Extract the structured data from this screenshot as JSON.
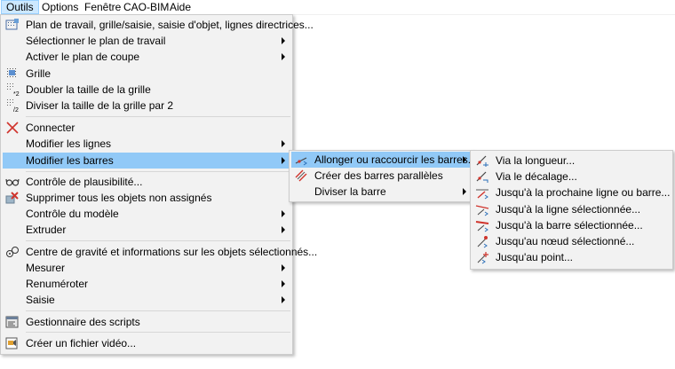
{
  "menubar": {
    "items": [
      "Outils",
      "Options",
      "Fenêtre",
      "CAO-BIM",
      "Aide"
    ]
  },
  "outils_menu": {
    "items": [
      {
        "label": "Plan de travail, grille/saisie, saisie d'objet, lignes directrices...",
        "icon": "workplane-grid-icon"
      },
      {
        "label": "Sélectionner le plan de travail",
        "submenu": true
      },
      {
        "label": "Activer le plan de coupe",
        "submenu": true
      },
      {
        "label": "Grille",
        "icon": "grid-icon"
      },
      {
        "label": "Doubler la taille de la grille",
        "icon": "grid-double-icon"
      },
      {
        "label": "Diviser la taille de la grille par 2",
        "icon": "grid-half-icon"
      },
      {
        "label": "Connecter",
        "icon": "connect-cross-icon"
      },
      {
        "label": "Modifier les lignes",
        "submenu": true
      },
      {
        "label": "Modifier les barres",
        "submenu": true,
        "highlighted": true
      },
      {
        "label": "Contrôle de plausibilité...",
        "icon": "glasses-icon"
      },
      {
        "label": "Supprimer tous les objets non assignés",
        "icon": "delete-unassigned-icon"
      },
      {
        "label": "Contrôle du modèle",
        "submenu": true
      },
      {
        "label": "Extruder",
        "submenu": true
      },
      {
        "label": "Centre de gravité et informations sur les objets sélectionnés...",
        "icon": "center-of-gravity-icon"
      },
      {
        "label": "Mesurer",
        "submenu": true
      },
      {
        "label": "Renuméroter",
        "submenu": true
      },
      {
        "label": "Saisie",
        "submenu": true
      },
      {
        "label": "Gestionnaire des scripts",
        "icon": "script-manager-icon"
      },
      {
        "label": "Créer un fichier vidéo...",
        "icon": "video-file-icon"
      }
    ]
  },
  "barres_menu": {
    "items": [
      {
        "label": "Allonger ou raccourcir les barres...",
        "submenu": true,
        "highlighted": true,
        "icon": "extend-member-icon"
      },
      {
        "label": "Créer des barres parallèles",
        "icon": "parallel-members-icon"
      },
      {
        "label": "Diviser la barre",
        "submenu": true
      }
    ]
  },
  "allonger_menu": {
    "items": [
      {
        "label": "Via la longueur...",
        "icon": "by-length-icon"
      },
      {
        "label": "Via le décalage...",
        "icon": "by-offset-icon"
      },
      {
        "label": "Jusqu'à la prochaine ligne ou barre...",
        "icon": "to-next-line-icon"
      },
      {
        "label": "Jusqu'à la ligne sélectionnée...",
        "icon": "to-selected-line-icon"
      },
      {
        "label": "Jusqu'à la barre sélectionnée...",
        "icon": "to-selected-member-icon"
      },
      {
        "label": "Jusqu'au nœud sélectionné...",
        "icon": "to-selected-node-icon"
      },
      {
        "label": "Jusqu'au point...",
        "icon": "to-point-icon"
      }
    ]
  },
  "colors": {
    "highlight": "#91c9f7",
    "menu_bg": "#f2f2f2",
    "active_tab": "#cce8ff"
  }
}
